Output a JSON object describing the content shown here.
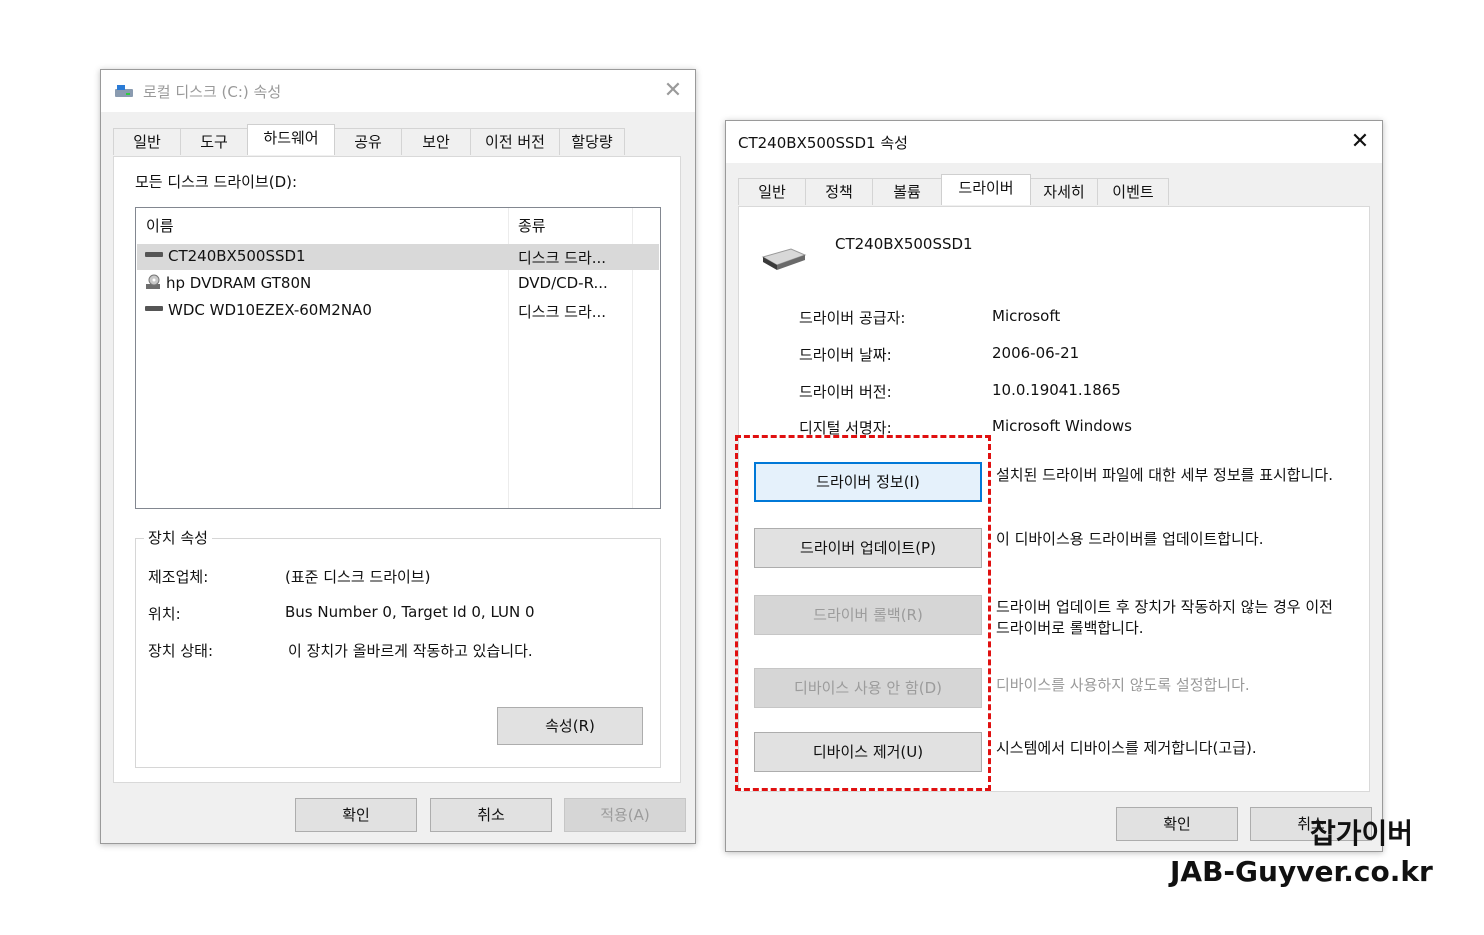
{
  "left_window": {
    "title": "로컬 디스크 (C:) 속성",
    "tabs": [
      "일반",
      "도구",
      "하드웨어",
      "공유",
      "보안",
      "이전 버전",
      "할당량"
    ],
    "active_tab": "하드웨어",
    "drives_label": "모든 디스크 드라이브(D):",
    "columns": [
      "이름",
      "종류"
    ],
    "rows": [
      {
        "name": "CT240BX500SSD1",
        "type": "디스크 드라...",
        "icon": "drive-icon"
      },
      {
        "name": "hp DVDRAM GT80N",
        "type": "DVD/CD-R...",
        "icon": "cd-drive-icon"
      },
      {
        "name": "WDC WD10EZEX-60M2NA0",
        "type": "디스크 드라...",
        "icon": "drive-icon"
      }
    ],
    "device_props": {
      "title": "장치 속성",
      "manufacturer_label": "제조업체:",
      "manufacturer_value": "(표준 디스크 드라이브)",
      "location_label": "위치:",
      "location_value": "Bus Number 0, Target Id 0, LUN 0",
      "status_label": "장치 상태:",
      "status_value": "이 장치가 올바르게 작동하고 있습니다.",
      "properties_button": "속성(R)"
    },
    "buttons": {
      "ok": "확인",
      "cancel": "취소",
      "apply": "적용(A)"
    }
  },
  "right_window": {
    "title": "CT240BX500SSD1 속성",
    "tabs": [
      "일반",
      "정책",
      "볼륨",
      "드라이버",
      "자세히",
      "이벤트"
    ],
    "active_tab": "드라이버",
    "device_name": "CT240BX500SSD1",
    "info": [
      {
        "label": "드라이버 공급자:",
        "value": "Microsoft"
      },
      {
        "label": "드라이버 날짜:",
        "value": "2006-06-21"
      },
      {
        "label": "드라이버 버전:",
        "value": "10.0.19041.1865"
      },
      {
        "label": "디지털 서명자:",
        "value": "Microsoft Windows"
      }
    ],
    "actions": [
      {
        "button": "드라이버 정보(I)",
        "desc": "설치된 드라이버 파일에 대한 세부 정보를 표시합니다.",
        "enabled": true
      },
      {
        "button": "드라이버 업데이트(P)",
        "desc": "이 디바이스용 드라이버를 업데이트합니다.",
        "enabled": true
      },
      {
        "button": "드라이버 롤백(R)",
        "desc": "드라이버 업데이트 후 장치가 작동하지 않는 경우 이전 드라이버로 롤백합니다.",
        "enabled": false
      },
      {
        "button": "디바이스 사용 안 함(D)",
        "desc": "디바이스를 사용하지 않도록 설정합니다.",
        "enabled": false
      },
      {
        "button": "디바이스 제거(U)",
        "desc": "시스템에서 디바이스를 제거합니다(고급).",
        "enabled": true
      }
    ],
    "buttons": {
      "ok": "확인",
      "cancel": "취소"
    }
  },
  "watermark": {
    "line1": "잡가이버",
    "line2": "JAB-Guyver.co.kr"
  },
  "colors": {
    "highlight_border": "#e01010",
    "focus_border": "#0078d7"
  }
}
